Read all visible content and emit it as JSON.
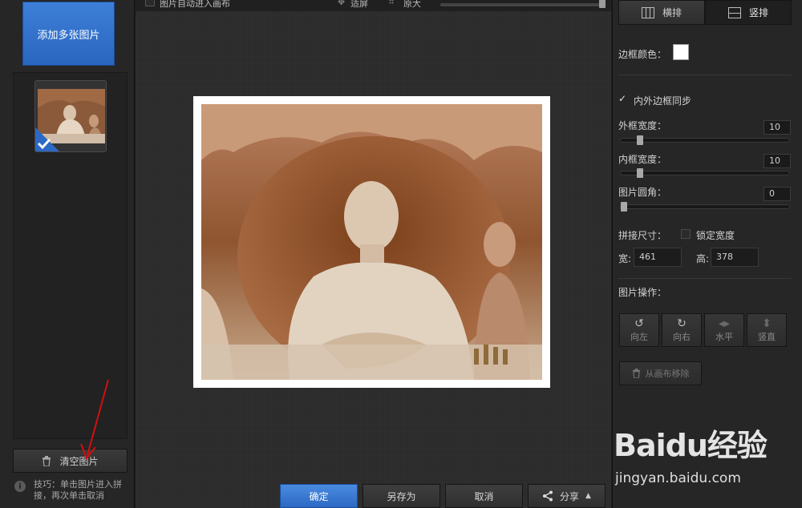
{
  "left_panel": {
    "add_button": "添加多张图片",
    "clear_button": "清空图片",
    "tip": "技巧：单击图片进入拼接，再次单击取消",
    "tip_icon": "info-icon"
  },
  "toolbar": {
    "auto_canvas_label": "图片自动进入画布",
    "fit_label": "适屏",
    "original_label": "原大",
    "zoom_value": 1.0
  },
  "actions": {
    "ok": "确定",
    "save_as": "另存为",
    "cancel": "取消",
    "share": "分享"
  },
  "right_panel": {
    "tab_horizontal": "横排",
    "tab_vertical": "竖排",
    "border_color_label": "边框颜色：",
    "border_color": "#ffffff",
    "sync_label": "内外边框同步",
    "sync_checked": true,
    "outer_width_label": "外框宽度：",
    "outer_width_value": "10",
    "inner_width_label": "内框宽度：",
    "inner_width_value": "10",
    "corner_label": "图片圆角：",
    "corner_value": "0",
    "size_label": "拼接尺寸：",
    "lock_width_label": "锁定宽度",
    "width_label": "宽:",
    "width_value": "461",
    "height_label": "高:",
    "height_value": "378",
    "ops_label": "图片操作：",
    "op_left": "向左",
    "op_right": "向右",
    "op_horizontal": "水平",
    "op_vertical": "竖直",
    "remove_label": "从画布移除"
  },
  "watermark": {
    "logo": "Baidu经验",
    "url": "jingyan.baidu.com"
  },
  "colors": {
    "accent_blue": "#2f6fca",
    "panel_bg": "#262626",
    "canvas_bg": "#2a2a2a"
  }
}
